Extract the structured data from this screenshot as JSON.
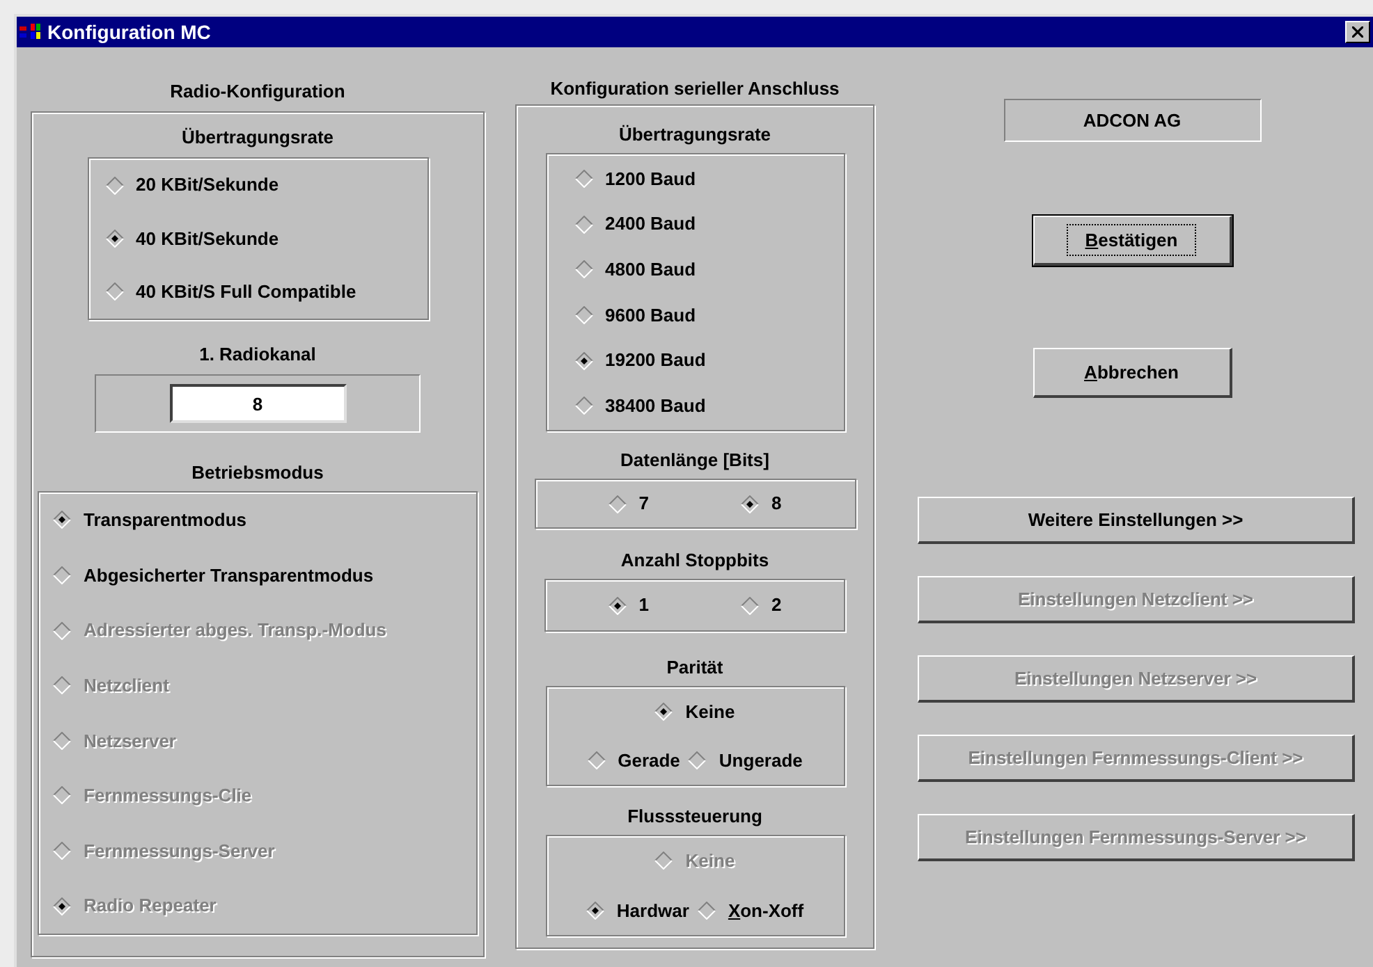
{
  "window": {
    "title": "Konfiguration MC"
  },
  "radio_config": {
    "title": "Radio-Konfiguration",
    "rate": {
      "label": "Übertragungsrate",
      "kind": "stacked",
      "options": [
        {
          "label": "20 KBit/Sekunde",
          "selected": false,
          "disabled": false
        },
        {
          "label": "40 KBit/Sekunde",
          "selected": true,
          "disabled": false
        },
        {
          "label": "40 KBit/S Full Compatible",
          "selected": false,
          "disabled": false
        }
      ]
    },
    "channel": {
      "label": "1. Radiokanal",
      "value": "8"
    },
    "mode": {
      "label": "Betriebsmodus",
      "kind": "stacked",
      "options": [
        {
          "label": "Transparentmodus",
          "selected": true,
          "disabled": false
        },
        {
          "label": "Abgesicherter Transparentmodus",
          "selected": false,
          "disabled": false
        },
        {
          "label": "Adressierter abges. Transp.-Modus",
          "selected": false,
          "disabled": true
        },
        {
          "label": "Netzclient",
          "selected": false,
          "disabled": true
        },
        {
          "label": "Netzserver",
          "selected": false,
          "disabled": true
        },
        {
          "label": "Fernmessungs-Clie",
          "selected": false,
          "disabled": true
        },
        {
          "label": "Fernmessungs-Server",
          "selected": false,
          "disabled": true
        },
        {
          "label": "Radio Repeater",
          "selected": true,
          "disabled": true
        }
      ]
    }
  },
  "serial": {
    "title": "Konfiguration serieller Anschluss",
    "groups": [
      {
        "label": "Übertragungsrate",
        "kind": "stacked",
        "options": [
          {
            "label": "1200 Baud",
            "selected": false,
            "disabled": false
          },
          {
            "label": "2400 Baud",
            "selected": false,
            "disabled": false
          },
          {
            "label": "4800 Baud",
            "selected": false,
            "disabled": false
          },
          {
            "label": "9600 Baud",
            "selected": false,
            "disabled": false
          },
          {
            "label": "19200 Baud",
            "selected": true,
            "disabled": false
          },
          {
            "label": "38400 Baud",
            "selected": false,
            "disabled": false
          }
        ]
      },
      {
        "label": "Datenlänge [Bits]",
        "kind": "row",
        "options": [
          {
            "label": "7",
            "selected": false,
            "disabled": false
          },
          {
            "label": "8",
            "selected": true,
            "disabled": false
          }
        ]
      },
      {
        "label": "Anzahl Stoppbits",
        "kind": "row",
        "options": [
          {
            "label": "1",
            "selected": true,
            "disabled": false
          },
          {
            "label": "2",
            "selected": false,
            "disabled": false
          }
        ]
      },
      {
        "label": "Parität",
        "kind": "split",
        "options": [
          {
            "label": "Keine",
            "selected": true,
            "disabled": false
          },
          {
            "label": "Gerade",
            "selected": false,
            "disabled": false
          },
          {
            "label": "Ungerade",
            "selected": false,
            "disabled": false
          }
        ]
      },
      {
        "label": "Flusssteuerung",
        "kind": "split",
        "options": [
          {
            "label": "Keine",
            "selected": false,
            "disabled": true
          },
          {
            "label": "Hardwar",
            "selected": true,
            "disabled": false
          },
          {
            "label": "Xon-Xoff",
            "selected": false,
            "disabled": false,
            "mnemonic": true
          }
        ]
      }
    ]
  },
  "company": "ADCON AG",
  "buttons": [
    {
      "label": "Bestätigen",
      "default": true,
      "mnemonic": true
    },
    {
      "label": "Abbrechen",
      "default": false,
      "mnemonic": true
    }
  ],
  "more_buttons": [
    {
      "label": "Weitere Einstellungen >>",
      "disabled": false
    },
    {
      "label": "Einstellungen Netzclient >>",
      "disabled": true
    },
    {
      "label": "Einstellungen Netzserver >>",
      "disabled": true
    },
    {
      "label": "Einstellungen Fernmessungs-Client >>",
      "disabled": true
    },
    {
      "label": "Einstellungen Fernmessungs-Server >>",
      "disabled": true
    }
  ]
}
